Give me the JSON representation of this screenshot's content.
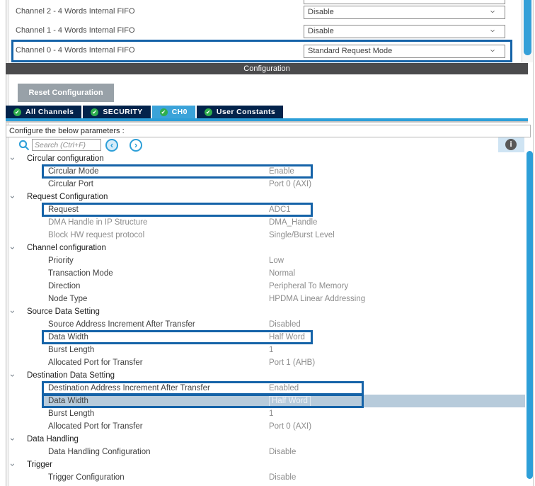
{
  "top_panel": {
    "channels": [
      {
        "label": "Channel 2  - 4 Words Internal FIFO",
        "value": "Disable",
        "highlighted": false
      },
      {
        "label": "Channel 1  - 4 Words Internal FIFO",
        "value": "Disable",
        "highlighted": false
      },
      {
        "label": "Channel 0  - 4 Words Internal FIFO",
        "value": "Standard Request Mode",
        "highlighted": true
      }
    ]
  },
  "config_bar": {
    "title": "Configuration"
  },
  "toolbar": {
    "reset_button": "Reset Configuration"
  },
  "tabs": [
    {
      "label": "All Channels",
      "selected": false
    },
    {
      "label": "SECURITY",
      "selected": false
    },
    {
      "label": "CH0",
      "selected": true
    },
    {
      "label": "User Constants",
      "selected": false
    }
  ],
  "params_header": "Configure the below parameters :",
  "search": {
    "placeholder": "Search (Ctrl+F)"
  },
  "icons": {
    "check": "✔",
    "chevron_down": "›",
    "prev": "‹",
    "next": "›",
    "info": "i"
  },
  "colors": {
    "annotation_blue": "#1563a8",
    "tab_navy": "#03234b",
    "tab_selected": "#3ba3d9",
    "accent_blue": "#2d9fd8",
    "check_green": "#2fae4d",
    "config_bar_gray": "#4b4b4d",
    "button_gray": "#98a1a8",
    "selected_row": "#b7cbdb",
    "value_gray": "#8d8d8d"
  },
  "tree": {
    "rows": [
      {
        "type": "section",
        "label": "Circular configuration"
      },
      {
        "type": "param",
        "label": "Circular Mode",
        "value": "Enable",
        "highlight": "narrow"
      },
      {
        "type": "param",
        "label": "Circular Port",
        "value": "Port 0 (AXI)"
      },
      {
        "type": "section",
        "label": "Request Configuration"
      },
      {
        "type": "param",
        "label": "Request",
        "value": "ADC1",
        "highlight": "narrow"
      },
      {
        "type": "param",
        "label": "DMA Handle in IP Structure",
        "value": "DMA_Handle",
        "muted": true
      },
      {
        "type": "param",
        "label": "Block HW request protocol",
        "value": "Single/Burst Level",
        "muted": true
      },
      {
        "type": "section",
        "label": "Channel configuration"
      },
      {
        "type": "param",
        "label": "Priority",
        "value": "Low"
      },
      {
        "type": "param",
        "label": "Transaction Mode",
        "value": "Normal"
      },
      {
        "type": "param",
        "label": "Direction",
        "value": "Peripheral To Memory"
      },
      {
        "type": "param",
        "label": "Node Type",
        "value": "HPDMA Linear Addressing"
      },
      {
        "type": "section",
        "label": "Source Data Setting"
      },
      {
        "type": "param",
        "label": "Source Address Increment After Transfer",
        "value": "Disabled"
      },
      {
        "type": "param",
        "label": "Data Width",
        "value": "Half Word",
        "highlight": "narrow"
      },
      {
        "type": "param",
        "label": "Burst Length",
        "value": "1"
      },
      {
        "type": "param",
        "label": "Allocated Port for Transfer",
        "value": "Port 1 (AHB)"
      },
      {
        "type": "section",
        "label": "Destination Data Setting"
      },
      {
        "type": "param",
        "label": "Destination Address Increment After Transfer",
        "value": "Enabled",
        "highlight": "wide"
      },
      {
        "type": "param",
        "label": "Data Width",
        "value": "Half Word",
        "highlight": "wide",
        "selected": true
      },
      {
        "type": "param",
        "label": "Burst Length",
        "value": "1"
      },
      {
        "type": "param",
        "label": "Allocated Port for Transfer",
        "value": "Port 0 (AXI)"
      },
      {
        "type": "section",
        "label": "Data Handling"
      },
      {
        "type": "param",
        "label": "Data Handling Configuration",
        "value": "Disable"
      },
      {
        "type": "section",
        "label": "Trigger"
      },
      {
        "type": "param",
        "label": "Trigger Configuration",
        "value": "Disable"
      }
    ]
  }
}
